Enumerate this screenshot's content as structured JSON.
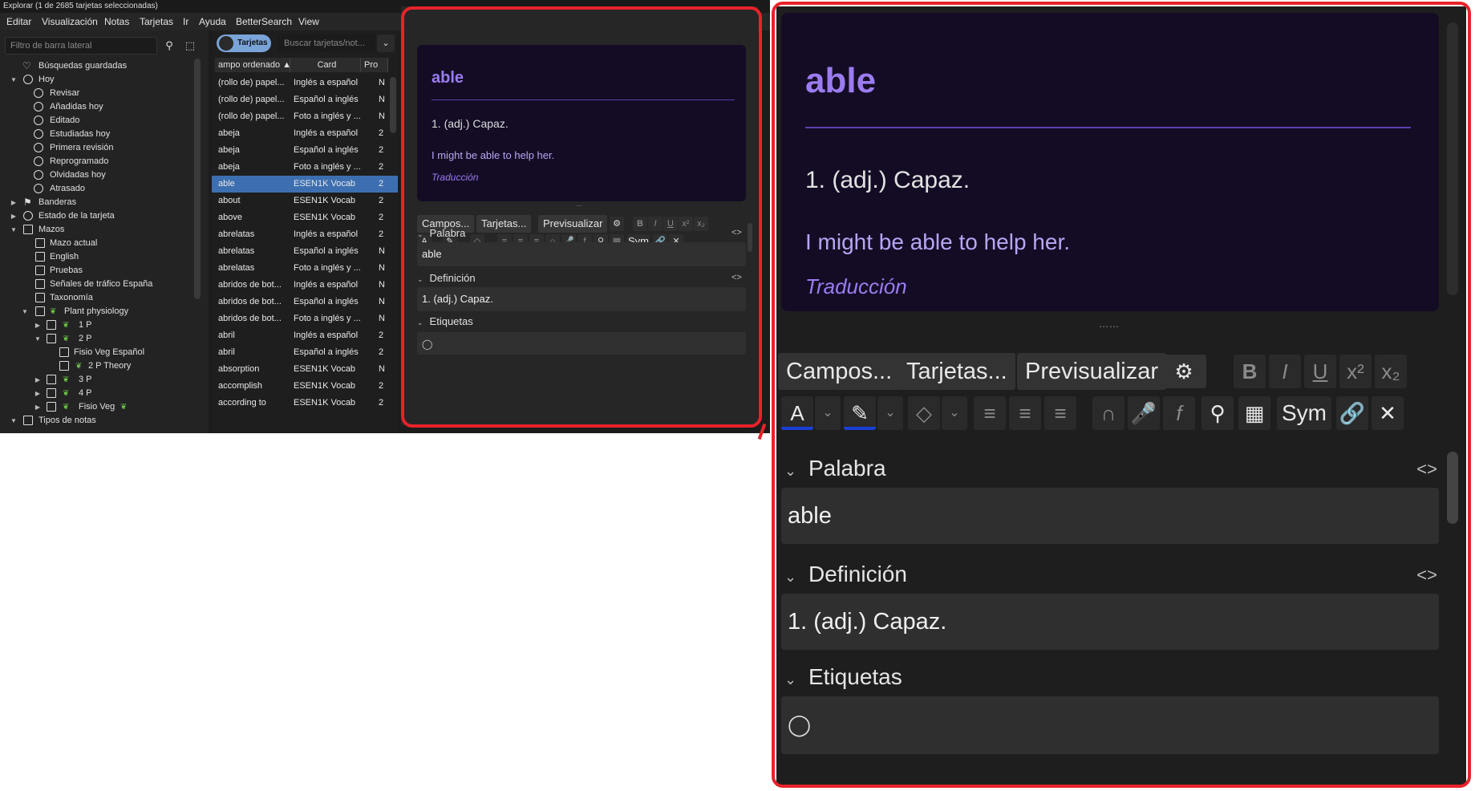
{
  "window": {
    "title": "Explorar (1 de 2685 tarjetas seleccionadas)"
  },
  "menu": [
    "Editar",
    "Visualización",
    "Notas",
    "Tarjetas",
    "Ir",
    "Ayuda",
    "BetterSearch",
    "View"
  ],
  "sidebar": {
    "filter_placeholder": "Filtro de barra lateral",
    "items": [
      {
        "label": "Búsquedas guardadas"
      },
      {
        "label": "Hoy"
      },
      {
        "label": "Revisar"
      },
      {
        "label": "Añadidas hoy"
      },
      {
        "label": "Editado"
      },
      {
        "label": "Estudiadas hoy"
      },
      {
        "label": "Primera revisión"
      },
      {
        "label": "Reprogramado"
      },
      {
        "label": "Olvidadas hoy"
      },
      {
        "label": "Atrasado"
      },
      {
        "label": "Banderas"
      },
      {
        "label": "Estado de la tarjeta"
      },
      {
        "label": "Mazos"
      },
      {
        "label": "Mazo actual"
      },
      {
        "label": "English"
      },
      {
        "label": "Pruebas"
      },
      {
        "label": "Señales de tráfico España"
      },
      {
        "label": "Taxonomía"
      },
      {
        "label": "Plant physiology"
      },
      {
        "label": "1 P"
      },
      {
        "label": "2 P"
      },
      {
        "label": "Fisio Veg Español"
      },
      {
        "label": "2 P Theory"
      },
      {
        "label": "3 P"
      },
      {
        "label": "4 P"
      },
      {
        "label": "Fisio Veg"
      },
      {
        "label": "Tipos de notas"
      }
    ]
  },
  "table": {
    "toggle_label": "Tarjetas",
    "search_placeholder": "Buscar tarjetas/not...",
    "columns": [
      "ampo ordenado",
      "Card",
      "Pro"
    ],
    "rows": [
      [
        "(rollo de) papel...",
        "Inglés a español",
        "N"
      ],
      [
        "(rollo de) papel...",
        "Español a inglés",
        "N"
      ],
      [
        "(rollo de) papel...",
        "Foto a inglés y ...",
        "N"
      ],
      [
        "abeja",
        "Inglés a español",
        "2"
      ],
      [
        "abeja",
        "Español a inglés",
        "2"
      ],
      [
        "abeja",
        "Foto a inglés y ...",
        "2"
      ],
      [
        "able",
        "ESEN1K Vocab",
        "2"
      ],
      [
        "about",
        "ESEN1K Vocab",
        "2"
      ],
      [
        "above",
        "ESEN1K Vocab",
        "2"
      ],
      [
        "abrelatas",
        "Inglés a español",
        "2"
      ],
      [
        "abrelatas",
        "Español a inglés",
        "N"
      ],
      [
        "abrelatas",
        "Foto a inglés y ...",
        "N"
      ],
      [
        "abridos de bot...",
        "Inglés a español",
        "N"
      ],
      [
        "abridos de bot...",
        "Español a inglés",
        "N"
      ],
      [
        "abridos de bot...",
        "Foto a inglés y ...",
        "N"
      ],
      [
        "abril",
        "Inglés a español",
        "2"
      ],
      [
        "abril",
        "Español a inglés",
        "2"
      ],
      [
        "absorption",
        "ESEN1K Vocab",
        "N"
      ],
      [
        "accomplish",
        "ESEN1K Vocab",
        "2"
      ],
      [
        "according to",
        "ESEN1K Vocab",
        "2"
      ]
    ]
  },
  "card": {
    "word": "able",
    "definition": "1. (adj.) Capaz.",
    "example": "I might be able to help her.",
    "translation_link": "Traducción"
  },
  "editor": {
    "tabs": [
      "Campos...",
      "Tarjetas...",
      "Previsualizar"
    ],
    "sym_label": "Sym",
    "fields": [
      {
        "name": "Palabra",
        "value": "able"
      },
      {
        "name": "Definición",
        "value": "1. (adj.) Capaz."
      }
    ],
    "tags_label": "Etiquetas"
  },
  "icons": {
    "settings": "gear-icon",
    "bold": "bold-icon",
    "italic": "italic-icon",
    "underline": "underline-icon",
    "superscript": "superscript-icon",
    "subscript": "subscript-icon",
    "tag": "tag-icon"
  },
  "colors": {
    "card_bg": "#140c25",
    "accent_purple": "#9b7cf0",
    "selection": "#3d6fb0",
    "highlight_frame": "#e8222a"
  }
}
